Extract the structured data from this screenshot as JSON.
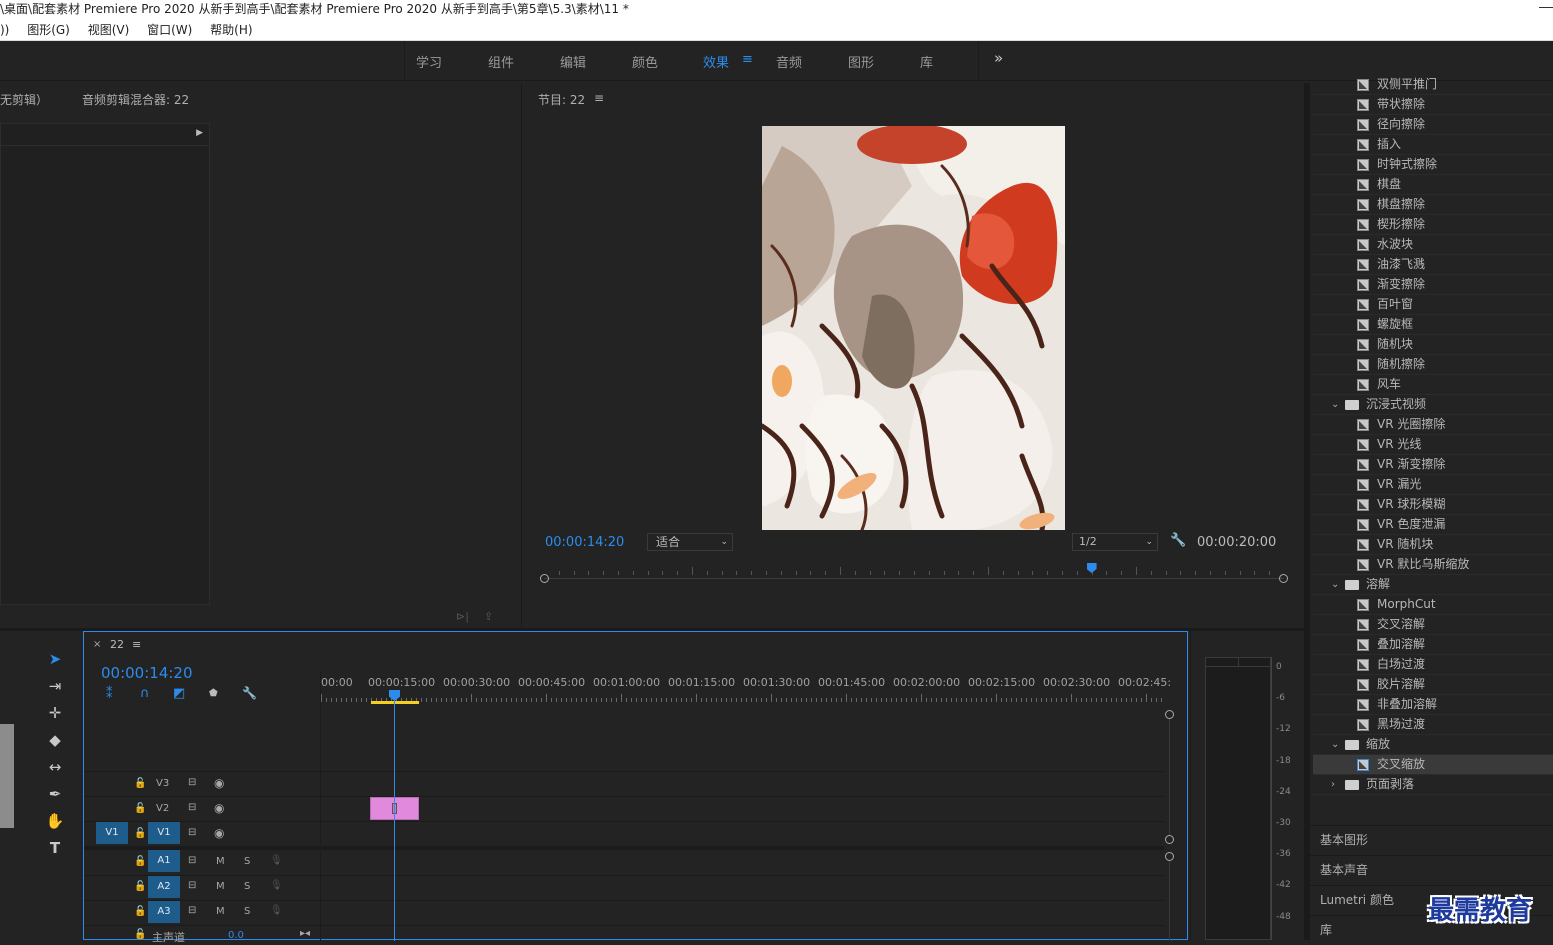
{
  "window": {
    "title": "\\桌面\\配套素材 Premiere Pro 2020 从新手到高手\\配套素材 Premiere Pro 2020 从新手到高手\\第5章\\5.3\\素材\\11 *"
  },
  "menu": {
    "items": [
      "))",
      "图形(G)",
      "视图(V)",
      "窗口(W)",
      "帮助(H)"
    ]
  },
  "workspaces": {
    "tabs": [
      "学习",
      "组件",
      "编辑",
      "颜色",
      "效果",
      "音频",
      "图形",
      "库"
    ],
    "active": "效果",
    "more_label": "»"
  },
  "source_panel": {
    "tab_clip": "无剪辑）",
    "tab_mixer": "音频剪辑混合器: 22"
  },
  "program_monitor": {
    "title": "节目: 22",
    "current_time": "00:00:14:20",
    "fit_label": "适合",
    "resolution_label": "1/2",
    "duration": "00:00:20:00",
    "playhead_fraction": 0.74
  },
  "timeline": {
    "sequence_name": "22",
    "current_time": "00:00:14:20",
    "ruler": [
      "00:00",
      "00:00:15:00",
      "00:00:30:00",
      "00:00:45:00",
      "00:01:00:00",
      "00:01:15:00",
      "00:01:30:00",
      "00:01:45:00",
      "00:02:00:00",
      "00:02:15:00",
      "00:02:30:00",
      "00:02:45:"
    ],
    "video_tracks": [
      {
        "name": "V3"
      },
      {
        "name": "V2"
      },
      {
        "name": "V1",
        "source": "V1"
      }
    ],
    "audio_tracks": [
      {
        "name": "A1",
        "m": "M",
        "s": "S"
      },
      {
        "name": "A2",
        "m": "M",
        "s": "S"
      },
      {
        "name": "A3",
        "m": "M",
        "s": "S"
      }
    ],
    "master": {
      "label": "主声道",
      "value": "0.0"
    },
    "clip_color": "#e089dd"
  },
  "audio_meter": {
    "labels": [
      "0",
      "-6",
      "-12",
      "-18",
      "-24",
      "-30",
      "-36",
      "-42",
      "-48"
    ]
  },
  "effects": {
    "rows": [
      {
        "type": "effect",
        "label": "双侧平推门"
      },
      {
        "type": "effect",
        "label": "带状擦除"
      },
      {
        "type": "effect",
        "label": "径向擦除"
      },
      {
        "type": "effect",
        "label": "插入"
      },
      {
        "type": "effect",
        "label": "时钟式擦除"
      },
      {
        "type": "effect",
        "label": "棋盘"
      },
      {
        "type": "effect",
        "label": "棋盘擦除"
      },
      {
        "type": "effect",
        "label": "楔形擦除"
      },
      {
        "type": "effect",
        "label": "水波块"
      },
      {
        "type": "effect",
        "label": "油漆飞溅"
      },
      {
        "type": "effect",
        "label": "渐变擦除"
      },
      {
        "type": "effect",
        "label": "百叶窗"
      },
      {
        "type": "effect",
        "label": "螺旋框"
      },
      {
        "type": "effect",
        "label": "随机块"
      },
      {
        "type": "effect",
        "label": "随机擦除"
      },
      {
        "type": "effect",
        "label": "风车"
      },
      {
        "type": "folder",
        "label": "沉浸式视频",
        "arrow": "⌄"
      },
      {
        "type": "effect",
        "label": "VR 光圈擦除"
      },
      {
        "type": "effect",
        "label": "VR 光线"
      },
      {
        "type": "effect",
        "label": "VR 渐变擦除"
      },
      {
        "type": "effect",
        "label": "VR 漏光"
      },
      {
        "type": "effect",
        "label": "VR 球形模糊"
      },
      {
        "type": "effect",
        "label": "VR 色度泄漏"
      },
      {
        "type": "effect",
        "label": "VR 随机块"
      },
      {
        "type": "effect",
        "label": "VR 默比乌斯缩放"
      },
      {
        "type": "folder",
        "label": "溶解",
        "arrow": "⌄"
      },
      {
        "type": "effect",
        "label": "MorphCut"
      },
      {
        "type": "effect",
        "label": "交叉溶解"
      },
      {
        "type": "effect",
        "label": "叠加溶解"
      },
      {
        "type": "effect",
        "label": "白场过渡"
      },
      {
        "type": "effect",
        "label": "胶片溶解"
      },
      {
        "type": "effect",
        "label": "非叠加溶解"
      },
      {
        "type": "effect",
        "label": "黑场过渡"
      },
      {
        "type": "folder",
        "label": "缩放",
        "arrow": "⌄"
      },
      {
        "type": "effect",
        "label": "交叉缩放",
        "selected": true
      },
      {
        "type": "folder",
        "label": "页面剥落",
        "arrow": "›"
      }
    ]
  },
  "side_panels": [
    "基本图形",
    "基本声音",
    "Lumetri 颜色",
    "库"
  ],
  "watermark": "最需教育",
  "colors": {
    "accent": "#2d8ceb",
    "track_blue": "#1e5c8c",
    "clip_pink": "#e089dd",
    "playhead_yellow": "#f5d020"
  }
}
